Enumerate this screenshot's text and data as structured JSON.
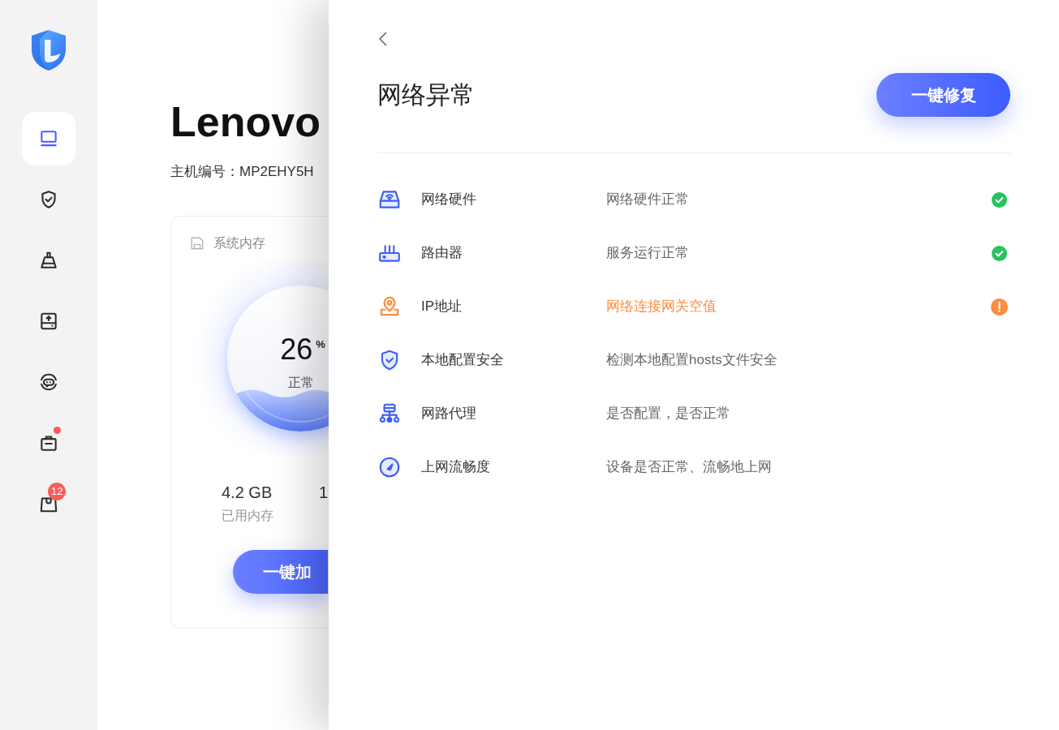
{
  "sidebar": {
    "items": [
      {
        "selected": true,
        "dot": false
      },
      {
        "selected": false,
        "dot": false
      },
      {
        "selected": false,
        "dot": false
      },
      {
        "selected": false,
        "dot": false
      },
      {
        "selected": false,
        "dot": false
      },
      {
        "selected": false,
        "dot": true
      },
      {
        "selected": false,
        "dot": false,
        "badge": "12"
      }
    ]
  },
  "device": {
    "name": "Lenovo",
    "serial": "主机编号：MP2EHY5H"
  },
  "memory_card": {
    "title": "系统内存",
    "gauge": {
      "value": "26",
      "unit": "%",
      "status": "正常",
      "level": 0.26
    },
    "stats": [
      {
        "value": "4.2 GB",
        "label": "已用内存"
      },
      {
        "value": "1"
      }
    ],
    "button": "一键加"
  },
  "drawer": {
    "title": "网络异常",
    "button": "一键修复",
    "checks": [
      {
        "name": "网络硬件",
        "detail": "网络硬件正常",
        "passed": true,
        "warning": false
      },
      {
        "name": "路由器",
        "detail": "服务运行正常",
        "passed": true,
        "warning": false
      },
      {
        "name": "IP地址",
        "detail": "网络连接网关空值",
        "passed": false,
        "warning": true
      },
      {
        "name": "本地配置安全",
        "detail": "检测本地配置hosts文件安全",
        "passed": false,
        "warning": false
      },
      {
        "name": "网路代理",
        "detail": "是否配置，是否正常",
        "passed": false,
        "warning": false
      },
      {
        "name": "上网流畅度",
        "detail": "设备是否正常、流畅地上网",
        "passed": false,
        "warning": false
      }
    ]
  }
}
